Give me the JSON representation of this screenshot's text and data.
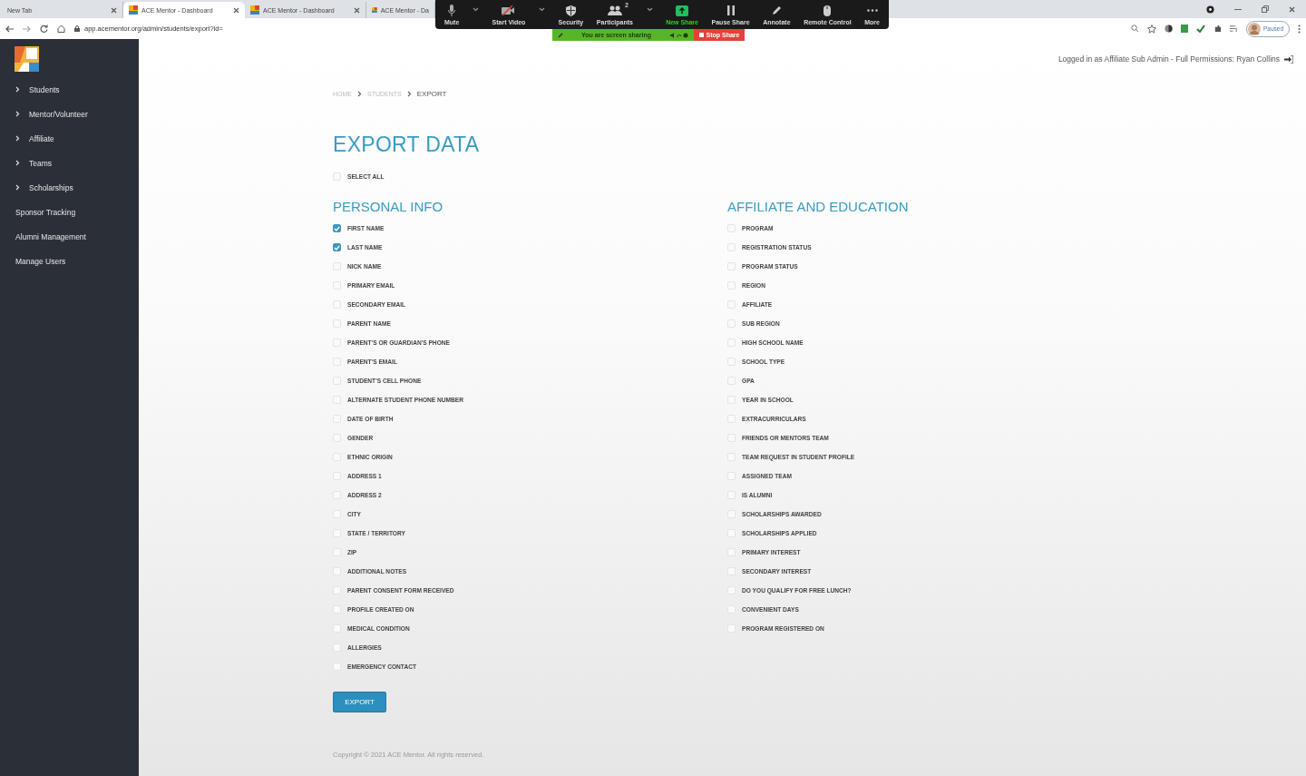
{
  "browser": {
    "tabs": [
      {
        "title": "New Tab",
        "selected": false,
        "favicon": false
      },
      {
        "title": "ACE Mentor - Dashboard",
        "selected": true,
        "favicon": true
      },
      {
        "title": "ACE Mentor - Dashboard",
        "selected": false,
        "favicon": true
      },
      {
        "title": "ACE Mentor - Da",
        "selected": false,
        "favicon": true
      }
    ],
    "url": "app.acementor.org/admin/students/export?id=",
    "profile": "Paused"
  },
  "meeting_toolbar": {
    "items": [
      {
        "label": "Mute",
        "kind": "mic",
        "caret": true
      },
      {
        "label": "Start Video",
        "kind": "video",
        "caret": true
      },
      {
        "label": "Security",
        "kind": "shield",
        "caret": false
      },
      {
        "label": "Participants",
        "kind": "people",
        "badge": "2",
        "caret": true
      },
      {
        "label": "New Share",
        "kind": "share",
        "caret": false
      },
      {
        "label": "Pause Share",
        "kind": "pause",
        "caret": false
      },
      {
        "label": "Annotate",
        "kind": "pen",
        "caret": false
      },
      {
        "label": "Remote Control",
        "kind": "mouse",
        "caret": false
      },
      {
        "label": "More",
        "kind": "dots",
        "caret": false
      }
    ],
    "sharing_notice": "You are screen sharing",
    "stop_button": "Stop Share"
  },
  "sidebar": {
    "items": [
      {
        "label": "Students",
        "expandable": true
      },
      {
        "label": "Mentor/Volunteer",
        "expandable": true
      },
      {
        "label": "Affiliate",
        "expandable": true
      },
      {
        "label": "Teams",
        "expandable": true
      },
      {
        "label": "Scholarships",
        "expandable": true
      },
      {
        "label": "Sponsor Tracking",
        "expandable": false
      },
      {
        "label": "Alumni Management",
        "expandable": false
      },
      {
        "label": "Manage Users",
        "expandable": false
      }
    ]
  },
  "header": {
    "login_info": "Logged in as Affiliate Sub Admin - Full Permissions: Ryan Collins"
  },
  "breadcrumb": [
    {
      "label": "HOME",
      "current": false
    },
    {
      "label": "STUDENTS",
      "current": false
    },
    {
      "label": "EXPORT",
      "current": true
    }
  ],
  "page_title": "EXPORT DATA",
  "select_all": {
    "label": "SELECT ALL",
    "checked": false
  },
  "sections": [
    {
      "title": "PERSONAL INFO",
      "fields": [
        {
          "label": "FIRST NAME",
          "checked": true
        },
        {
          "label": "LAST NAME",
          "checked": true
        },
        {
          "label": "NICK NAME",
          "checked": false
        },
        {
          "label": "PRIMARY EMAIL",
          "checked": false
        },
        {
          "label": "SECONDARY EMAIL",
          "checked": false
        },
        {
          "label": "PARENT NAME",
          "checked": false
        },
        {
          "label": "PARENT'S OR GUARDIAN'S PHONE",
          "checked": false
        },
        {
          "label": "PARENT'S EMAIL",
          "checked": false
        },
        {
          "label": "STUDENT'S CELL PHONE",
          "checked": false
        },
        {
          "label": "ALTERNATE STUDENT PHONE NUMBER",
          "checked": false
        },
        {
          "label": "DATE OF BIRTH",
          "checked": false
        },
        {
          "label": "GENDER",
          "checked": false
        },
        {
          "label": "ETHNIC ORIGIN",
          "checked": false
        },
        {
          "label": "ADDRESS 1",
          "checked": false
        },
        {
          "label": "ADDRESS 2",
          "checked": false
        },
        {
          "label": "CITY",
          "checked": false
        },
        {
          "label": "STATE / TERRITORY",
          "checked": false
        },
        {
          "label": "ZIP",
          "checked": false
        },
        {
          "label": "ADDITIONAL NOTES",
          "checked": false
        },
        {
          "label": "PARENT CONSENT FORM RECEIVED",
          "checked": false
        },
        {
          "label": "PROFILE CREATED ON",
          "checked": false
        },
        {
          "label": "MEDICAL CONDITION",
          "checked": false
        },
        {
          "label": "ALLERGIES",
          "checked": false
        },
        {
          "label": "EMERGENCY CONTACT",
          "checked": false
        }
      ]
    },
    {
      "title": "AFFILIATE AND EDUCATION",
      "fields": [
        {
          "label": "PROGRAM",
          "checked": false
        },
        {
          "label": "REGISTRATION STATUS",
          "checked": false
        },
        {
          "label": "PROGRAM STATUS",
          "checked": false
        },
        {
          "label": "REGION",
          "checked": false
        },
        {
          "label": "AFFILIATE",
          "checked": false
        },
        {
          "label": "SUB REGION",
          "checked": false
        },
        {
          "label": "HIGH SCHOOL NAME",
          "checked": false
        },
        {
          "label": "SCHOOL TYPE",
          "checked": false
        },
        {
          "label": "GPA",
          "checked": false
        },
        {
          "label": "YEAR IN SCHOOL",
          "checked": false
        },
        {
          "label": "EXTRACURRICULARS",
          "checked": false
        },
        {
          "label": "FRIENDS OR MENTORS TEAM",
          "checked": false
        },
        {
          "label": "TEAM REQUEST IN STUDENT PROFILE",
          "checked": false
        },
        {
          "label": "ASSIGNED TEAM",
          "checked": false
        },
        {
          "label": "IS ALUMNI",
          "checked": false
        },
        {
          "label": "SCHOLARSHIPS AWARDED",
          "checked": false
        },
        {
          "label": "SCHOLARSHIPS APPLIED",
          "checked": false
        },
        {
          "label": "PRIMARY INTEREST",
          "checked": false
        },
        {
          "label": "SECONDARY INTEREST",
          "checked": false
        },
        {
          "label": "DO YOU QUALIFY FOR FREE LUNCH?",
          "checked": false
        },
        {
          "label": "CONVENIENT DAYS",
          "checked": false
        },
        {
          "label": "PROGRAM REGISTERED ON",
          "checked": false
        }
      ]
    }
  ],
  "export_button": "EXPORT",
  "footer": "Copyright © 2021 ACE Mentor. All rights reserved."
}
